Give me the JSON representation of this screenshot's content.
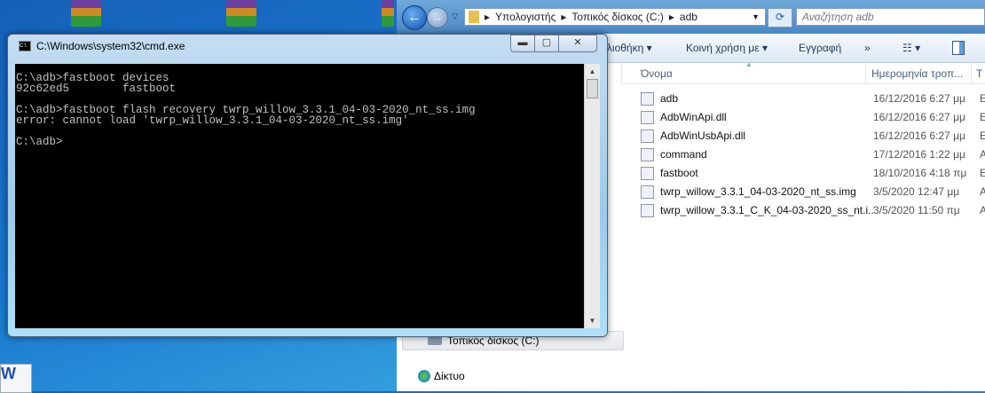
{
  "explorer": {
    "breadcrumb": [
      "Υπολογιστής",
      "Τοπικός δίσκος (C:)",
      "adb"
    ],
    "search_placeholder": "Αναζήτηση adb",
    "toolbar": {
      "library": "βλιοθήκη ▾",
      "share": "Κοινή χρήση με ▾",
      "burn": "Εγγραφή",
      "more": "»"
    },
    "columns": {
      "name": "Όνομα",
      "date": "Ημερομηνία τροπ...",
      "type": "Τ"
    },
    "files": [
      {
        "name": "adb",
        "date": "16/12/2016 6:27 μμ",
        "type": "Ε",
        "icon": "exe-icon"
      },
      {
        "name": "AdbWinApi.dll",
        "date": "16/12/2016 6:27 μμ",
        "type": "Ε",
        "icon": "dll-icon"
      },
      {
        "name": "AdbWinUsbApi.dll",
        "date": "16/12/2016 6:27 μμ",
        "type": "Ε",
        "icon": "dll-icon"
      },
      {
        "name": "command",
        "date": "17/12/2016 1:22 μμ",
        "type": "Α",
        "icon": "batch-icon"
      },
      {
        "name": "fastboot",
        "date": "18/10/2016 4:18 πμ",
        "type": "Ε",
        "icon": "exe-icon"
      },
      {
        "name": "twrp_willow_3.3.1_04-03-2020_nt_ss.img",
        "date": "3/5/2020 12:47 μμ",
        "type": "Α",
        "icon": "img-file-icon"
      },
      {
        "name": "twrp_willow_3.3.1_C_K_04-03-2020_ss_nt.i...",
        "date": "3/5/2020 11:50 πμ",
        "type": "Α",
        "icon": "img-file-icon"
      }
    ],
    "nav": {
      "local_disk": "Τοπικός δίσκος (C:)",
      "network": "Δίκτυο"
    }
  },
  "cmd": {
    "title": "C:\\Windows\\system32\\cmd.exe",
    "output": "C:\\adb>fastboot devices\n92c62ed5        fastboot\n\nC:\\adb>fastboot flash recovery twrp_willow_3.3.1_04-03-2020_nt_ss.img\nerror: cannot load 'twrp_willow_3.3.1_04-03-2020_nt_ss.img'\n\nC:\\adb>"
  }
}
